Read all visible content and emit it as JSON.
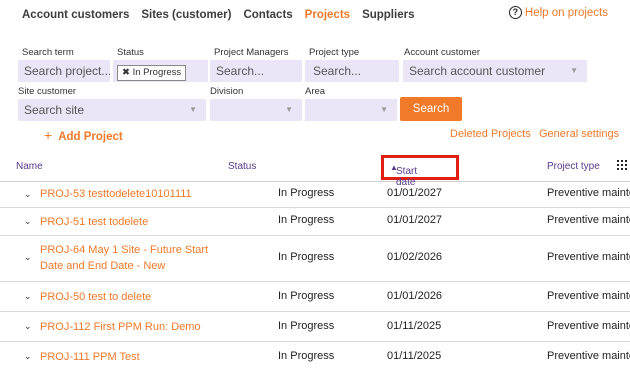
{
  "nav": {
    "tabs": [
      "Account customers",
      "Sites (customer)",
      "Contacts",
      "Projects",
      "Suppliers"
    ],
    "active": "Projects",
    "help_label": "Help on projects"
  },
  "filters": {
    "search_term_label": "Search term",
    "search_term_placeholder": "Search project...",
    "status_label": "Status",
    "status_chip": "In Progress",
    "pm_label": "Project Managers",
    "pm_placeholder": "Search...",
    "type_label": "Project type",
    "type_placeholder": "Search...",
    "account_label": "Account customer",
    "account_placeholder": "Search account customer",
    "site_label": "Site customer",
    "site_placeholder": "Search site",
    "division_label": "Division",
    "area_label": "Area",
    "search_button": "Search"
  },
  "actions": {
    "add_project": "Add Project",
    "deleted_projects": "Deleted Projects",
    "general_settings": "General settings"
  },
  "table": {
    "headers": {
      "name": "Name",
      "status": "Status",
      "start_date": "Start date",
      "project_type": "Project type"
    },
    "rows": [
      {
        "name": "PROJ-53 testtodelete10101111",
        "status": "In Progress",
        "start_date": "01/01/2027",
        "project_type": "Preventive mainter"
      },
      {
        "name": "PROJ-51 test todelete",
        "status": "In Progress",
        "start_date": "01/01/2027",
        "project_type": "Preventive mainter"
      },
      {
        "name": "PROJ-64 May 1 Site - Future Start Date and End Date - New",
        "status": "In Progress",
        "start_date": "01/02/2026",
        "project_type": "Preventive mainter"
      },
      {
        "name": "PROJ-50 test to delete",
        "status": "In Progress",
        "start_date": "01/01/2026",
        "project_type": "Preventive mainter"
      },
      {
        "name": "PROJ-112 First PPM Run: Demo",
        "status": "In Progress",
        "start_date": "01/11/2025",
        "project_type": "Preventive mainter"
      },
      {
        "name": "PROJ-111 PPM Test",
        "status": "In Progress",
        "start_date": "01/11/2025",
        "project_type": "Preventive mainter"
      }
    ]
  },
  "colors": {
    "accent": "#f07a2a",
    "field_bg": "#ebe6f7",
    "header_text": "#5a3a8a",
    "sort_highlight": "#e02010"
  }
}
